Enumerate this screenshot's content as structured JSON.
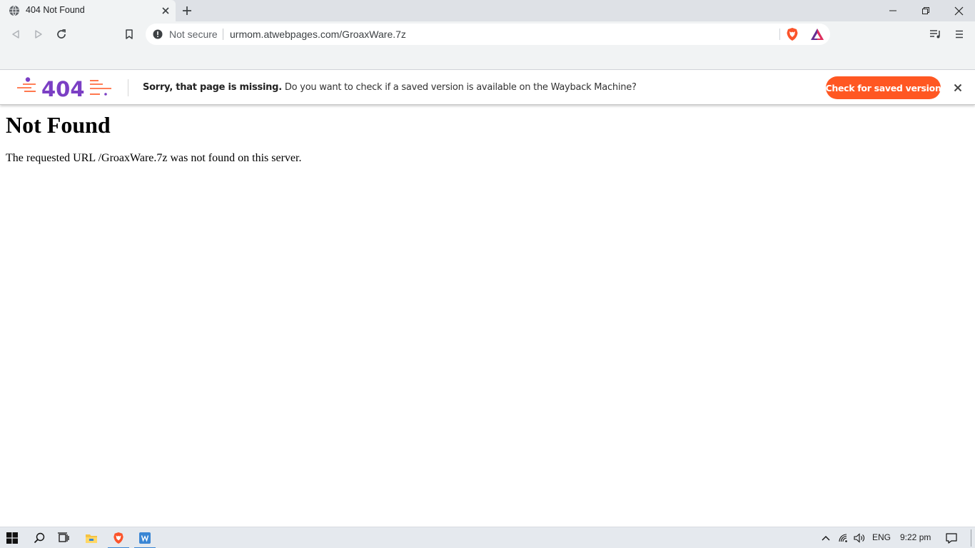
{
  "browser": {
    "tab": {
      "title": "404 Not Found"
    },
    "address_bar": {
      "security_label": "Not secure",
      "url": "urmom.atwebpages.com/GroaxWare.7z"
    }
  },
  "wayback_bar": {
    "logo_text": "404",
    "message_bold": "Sorry, that page is missing.",
    "message": "Do you want to check if a saved version is available on the Wayback Machine?",
    "button_label": "Check for saved version",
    "button_color": "#ff5722"
  },
  "page": {
    "heading": "Not Found",
    "body": "The requested URL /GroaxWare.7z was not found on this server."
  },
  "taskbar": {
    "language": "ENG",
    "time": "9:22 pm"
  }
}
